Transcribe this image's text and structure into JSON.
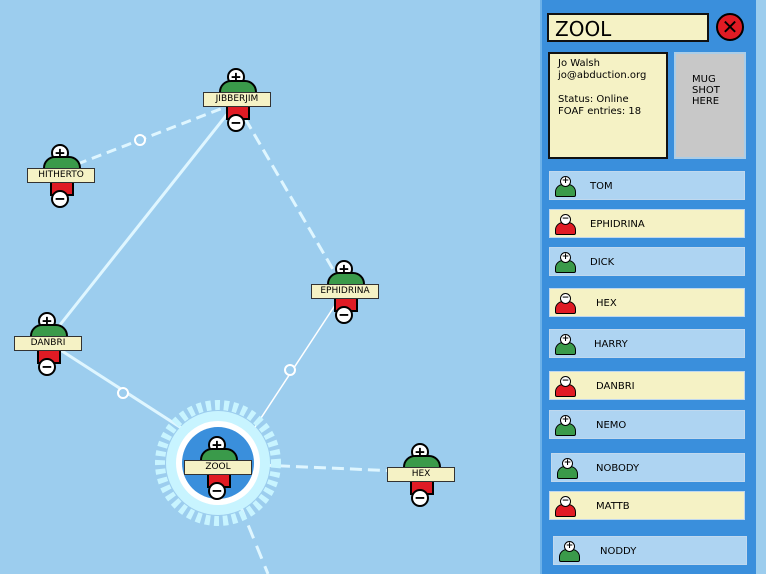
{
  "graph": {
    "nodes": {
      "jibberjim": {
        "label": "JIBBERJIM"
      },
      "hitherto": {
        "label": "HITHERTO"
      },
      "ephidrina": {
        "label": "EPHIDRINA"
      },
      "danbri": {
        "label": "DANBRI"
      },
      "zool": {
        "label": "ZOOL"
      },
      "hex": {
        "label": "HEX"
      }
    },
    "plus_glyph": "+",
    "minus_glyph": "−"
  },
  "panel": {
    "title": "ZOOL",
    "close_glyph": "✕",
    "info": {
      "name": "Jo Walsh",
      "email": "jo@abduction.org",
      "status": "Status: Online",
      "foaf": "FOAF entries: 18"
    },
    "mugshot": [
      "MUG",
      "SHOT",
      "HERE"
    ],
    "people": [
      {
        "name": "TOM",
        "state": "+"
      },
      {
        "name": "EPHIDRINA",
        "state": "−"
      },
      {
        "name": "DICK",
        "state": "+"
      },
      {
        "name": "HEX",
        "state": "−"
      },
      {
        "name": "HARRY",
        "state": "+"
      },
      {
        "name": "DANBRI",
        "state": "−"
      },
      {
        "name": "NEMO",
        "state": "+"
      },
      {
        "name": "NOBODY",
        "state": "+"
      },
      {
        "name": "MATTB",
        "state": "−"
      },
      {
        "name": "NODDY",
        "state": "+"
      }
    ]
  }
}
